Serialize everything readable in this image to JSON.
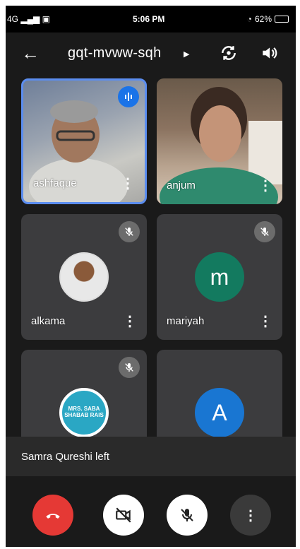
{
  "status": {
    "left": "4G",
    "time": "5:06 PM",
    "battery": "62%"
  },
  "topbar": {
    "meeting_code": "gqt-mvww-sqh"
  },
  "participants": [
    {
      "name": "ashfaque"
    },
    {
      "name": "anjum"
    },
    {
      "name": "alkama"
    },
    {
      "name": "mariyah",
      "avatar_letter": "m"
    },
    {
      "name": "",
      "avatar_text": "MRS. SABA SHABAB RAIS"
    },
    {
      "name": "",
      "avatar_letter": "A"
    }
  ],
  "toast": {
    "message": "Samra Qureshi left"
  },
  "colors": {
    "end_call": "#e53935",
    "speaking": "#1a73e8",
    "avatar_m": "#137a5f",
    "avatar_A": "#1976d2"
  }
}
